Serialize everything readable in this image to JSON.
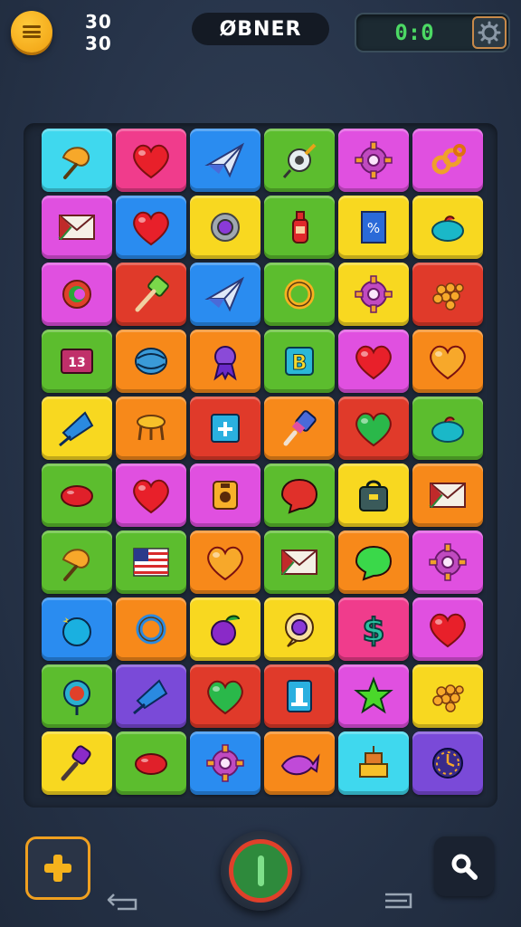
{
  "header": {
    "counter_top": "30",
    "counter_bottom": "30",
    "title": "ØBNER",
    "timer": "0:0",
    "menu_icon": "hamburger-icon",
    "settings_icon": "settings-icon"
  },
  "colors": {
    "cyan": "#3fd8ee",
    "pink": "#f03c8c",
    "blue": "#2a8cf0",
    "green": "#5cbd2e",
    "magenta": "#e050e0",
    "yellow": "#f8d820",
    "red": "#e03a2a",
    "orange": "#f7891a",
    "purple": "#7a4ad8",
    "timer_green": "#4cd964",
    "accent_orange": "#f0a020"
  },
  "board": {
    "rows": [
      [
        {
          "bg": "cyan",
          "icon": "tack-icon"
        },
        {
          "bg": "pink",
          "icon": "heart-icon"
        },
        {
          "bg": "blue",
          "icon": "paper-plane-icon"
        },
        {
          "bg": "green",
          "icon": "pin-icon"
        },
        {
          "bg": "magenta",
          "icon": "gear-icon"
        },
        {
          "bg": "magenta",
          "icon": "rings-icon"
        }
      ],
      [
        {
          "bg": "magenta",
          "icon": "envelope-icon"
        },
        {
          "bg": "blue",
          "icon": "heart-icon"
        },
        {
          "bg": "yellow",
          "icon": "button-icon"
        },
        {
          "bg": "green",
          "icon": "bottle-icon"
        },
        {
          "bg": "yellow",
          "icon": "percent-card-icon"
        },
        {
          "bg": "yellow",
          "icon": "fruit-icon"
        }
      ],
      [
        {
          "bg": "magenta",
          "icon": "cycle-icon"
        },
        {
          "bg": "red",
          "icon": "hammer-icon"
        },
        {
          "bg": "blue",
          "icon": "paper-plane-icon"
        },
        {
          "bg": "green",
          "icon": "ring-icon"
        },
        {
          "bg": "yellow",
          "icon": "gear-icon"
        },
        {
          "bg": "red",
          "icon": "grapes-icon"
        }
      ],
      [
        {
          "bg": "green",
          "icon": "calendar-icon"
        },
        {
          "bg": "orange",
          "icon": "ball-icon"
        },
        {
          "bg": "orange",
          "icon": "ribbon-icon"
        },
        {
          "bg": "green",
          "icon": "letter-b-icon"
        },
        {
          "bg": "magenta",
          "icon": "heart-icon"
        },
        {
          "bg": "orange",
          "icon": "heart-icon"
        }
      ],
      [
        {
          "bg": "yellow",
          "icon": "kite-icon"
        },
        {
          "bg": "orange",
          "icon": "stool-icon"
        },
        {
          "bg": "red",
          "icon": "document-plus-icon"
        },
        {
          "bg": "orange",
          "icon": "brush-icon"
        },
        {
          "bg": "red",
          "icon": "heart-icon"
        },
        {
          "bg": "green",
          "icon": "fruit-icon"
        }
      ],
      [
        {
          "bg": "green",
          "icon": "bean-icon"
        },
        {
          "bg": "magenta",
          "icon": "heart-icon"
        },
        {
          "bg": "magenta",
          "icon": "camera-icon"
        },
        {
          "bg": "green",
          "icon": "chat-bubble-icon"
        },
        {
          "bg": "yellow",
          "icon": "bag-icon"
        },
        {
          "bg": "orange",
          "icon": "envelope-icon"
        }
      ],
      [
        {
          "bg": "green",
          "icon": "tack-icon"
        },
        {
          "bg": "green",
          "icon": "flag-icon"
        },
        {
          "bg": "orange",
          "icon": "heart-icon"
        },
        {
          "bg": "green",
          "icon": "envelope-icon"
        },
        {
          "bg": "orange",
          "icon": "chat-bubble-icon"
        },
        {
          "bg": "magenta",
          "icon": "gear-icon"
        }
      ],
      [
        {
          "bg": "blue",
          "icon": "blob-icon"
        },
        {
          "bg": "orange",
          "icon": "ring-icon"
        },
        {
          "bg": "yellow",
          "icon": "plum-icon"
        },
        {
          "bg": "yellow",
          "icon": "search-bubble-icon"
        },
        {
          "bg": "pink",
          "icon": "dollar-icon"
        },
        {
          "bg": "magenta",
          "icon": "heart-icon"
        }
      ],
      [
        {
          "bg": "green",
          "icon": "target-icon"
        },
        {
          "bg": "purple",
          "icon": "kite-icon"
        },
        {
          "bg": "red",
          "icon": "heart-icon"
        },
        {
          "bg": "red",
          "icon": "document-icon"
        },
        {
          "bg": "magenta",
          "icon": "star-icon"
        },
        {
          "bg": "yellow",
          "icon": "grapes-icon"
        }
      ],
      [
        {
          "bg": "yellow",
          "icon": "torch-icon"
        },
        {
          "bg": "green",
          "icon": "bean-icon"
        },
        {
          "bg": "blue",
          "icon": "gear-icon"
        },
        {
          "bg": "orange",
          "icon": "fish-icon"
        },
        {
          "bg": "cyan",
          "icon": "cake-icon"
        },
        {
          "bg": "purple",
          "icon": "clock-icon"
        }
      ]
    ]
  },
  "footer": {
    "add_icon": "plus-icon",
    "play_icon": "power-icon",
    "search_icon": "search-icon",
    "back_icon": "back-icon",
    "recent_icon": "recent-apps-icon"
  }
}
